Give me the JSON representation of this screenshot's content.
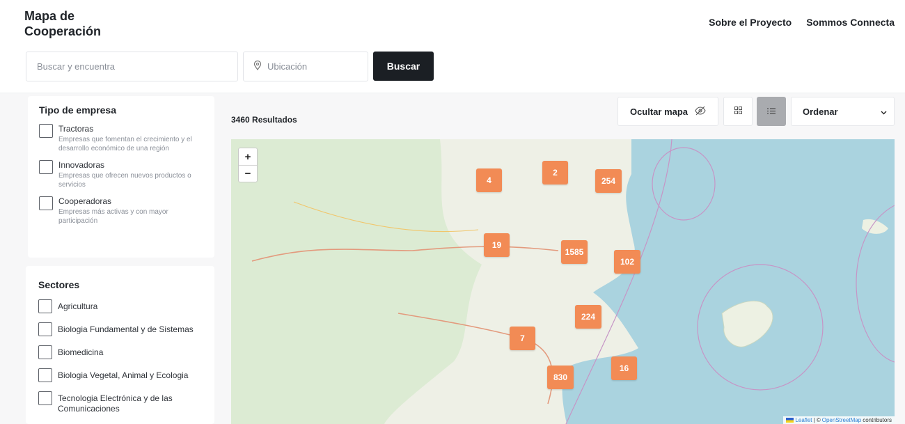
{
  "header": {
    "title": "Mapa de Cooperación",
    "nav": [
      "Sobre el Proyecto",
      "Sommos Connecta"
    ]
  },
  "search": {
    "query_placeholder": "Buscar y encuentra",
    "location_placeholder": "Ubicación",
    "button_label": "Buscar"
  },
  "filters": {
    "company_type": {
      "title": "Tipo de empresa",
      "options": [
        {
          "label": "Tractoras",
          "description": "Empresas que fomentan el crecimiento y el desarrollo económico de una región"
        },
        {
          "label": "Innovadoras",
          "description": "Empresas que ofrecen nuevos productos o servicios"
        },
        {
          "label": "Cooperadoras",
          "description": "Empresas más activas y con mayor participación"
        }
      ]
    },
    "sectors": {
      "title": "Sectores",
      "options": [
        "Agricultura",
        "Biologia Fundamental y de Sistemas",
        "Biomedicina",
        "Biologia Vegetal, Animal y Ecologia",
        "Tecnologia Electrónica y de las Comunicaciones"
      ]
    }
  },
  "results": {
    "count_label": "3460 Resultados",
    "hide_map_label": "Ocultar mapa",
    "sort_label": "Ordenar"
  },
  "map": {
    "zoom_in": "+",
    "zoom_out": "−",
    "clusters": [
      "4",
      "2",
      "254",
      "19",
      "1585",
      "102",
      "224",
      "7",
      "16",
      "830"
    ],
    "attribution": {
      "leaflet": "Leaflet",
      "separator": "| ©",
      "osm": "OpenStreetMap",
      "suffix": "contributors"
    }
  },
  "colors": {
    "cluster": "#f28b55",
    "sea": "#aad3df",
    "primary_button": "#1b1f24"
  },
  "icons": {
    "location": "map-pin-icon",
    "hide_map": "eye-off-icon",
    "grid": "grid-icon",
    "list": "list-icon",
    "sort": "chevron-down-icon"
  }
}
